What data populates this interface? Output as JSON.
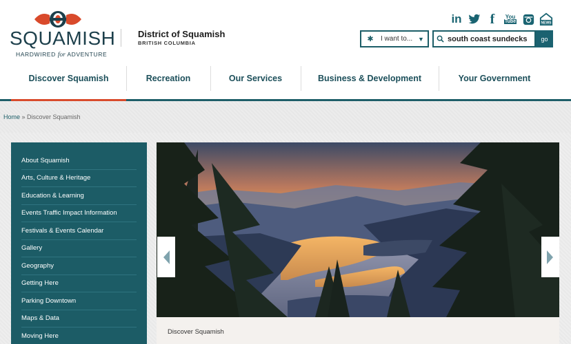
{
  "brand": {
    "logo_word": "SQUAMISH",
    "tagline_start": "HARDWIRED",
    "tagline_italic": "for",
    "tagline_end": "ADVENTURE",
    "district_name": "District of Squamish",
    "district_sub": "BRITISH COLUMBIA",
    "colors": {
      "teal": "#1c5c66",
      "red": "#d94a2b",
      "navy": "#1c3f4b"
    }
  },
  "social": [
    {
      "icon": "linkedin-icon",
      "glyph": "in"
    },
    {
      "icon": "twitter-icon",
      "glyph": "🐦"
    },
    {
      "icon": "facebook-icon",
      "glyph": "f"
    },
    {
      "icon": "youtube-icon",
      "glyph": "You Tube"
    },
    {
      "icon": "instagram-icon",
      "glyph": ""
    },
    {
      "icon": "news-icon",
      "glyph": "NEWS"
    }
  ],
  "utility": {
    "i_want_label": "I want to...",
    "search_value": "south coast sundecks",
    "go_label": "go"
  },
  "nav": [
    {
      "label": "Discover Squamish",
      "active": true
    },
    {
      "label": "Recreation",
      "active": false
    },
    {
      "label": "Our Services",
      "active": false
    },
    {
      "label": "Business & Development",
      "active": false
    },
    {
      "label": "Your Government",
      "active": false
    }
  ],
  "breadcrumb": {
    "home": "Home",
    "sep": " » ",
    "current": "Discover Squamish"
  },
  "sidebar": [
    "About Squamish",
    "Arts, Culture & Heritage",
    "Education & Learning",
    "Events Traffic Impact Information",
    "Festivals & Events Calendar",
    "Gallery",
    "Geography",
    "Getting Here",
    "Parking Downtown",
    "Maps & Data",
    "Moving Here"
  ],
  "hero": {
    "caption": "Discover Squamish"
  }
}
